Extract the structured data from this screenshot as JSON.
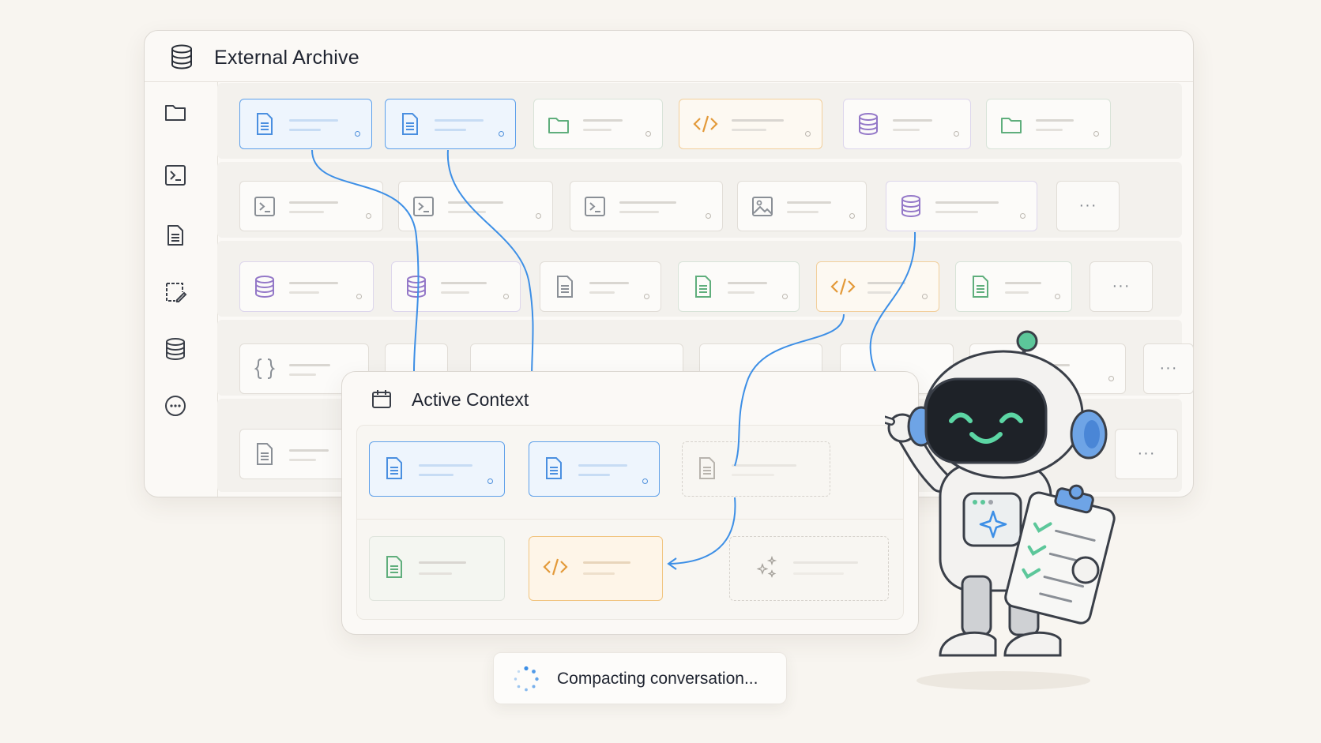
{
  "archive": {
    "title": "External Archive",
    "header_icon": "database-icon"
  },
  "sidebar": {
    "icons": [
      "folder-icon",
      "terminal-icon",
      "document-icon",
      "note-edit-icon",
      "database-icon",
      "more-icon"
    ]
  },
  "context": {
    "title": "Active Context",
    "header_icon": "calendar-icon"
  },
  "status": {
    "text": "Compacting conversation..."
  },
  "colors": {
    "link_blue": "#3d8fe6",
    "document_blue": "#4a8fe0",
    "code_orange": "#e39a3a",
    "database_purple": "#9478c8",
    "folder_green": "#5fae7c",
    "neutral_gray": "#8a8f96"
  }
}
